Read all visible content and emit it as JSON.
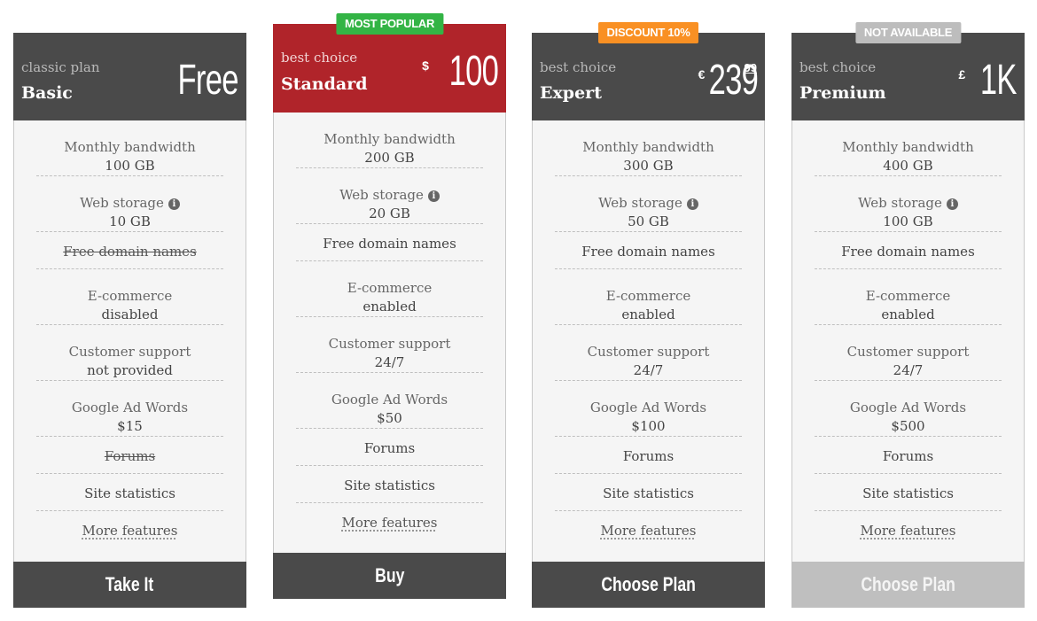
{
  "plans": [
    {
      "ribbon": "",
      "subtitle": "classic plan",
      "name": "Basic",
      "currency": "",
      "amount": "Free",
      "cents": "",
      "features": [
        {
          "label": "Monthly bandwidth",
          "value": "100 GB"
        },
        {
          "label": "Web storage",
          "value": "10 GB",
          "info": true
        },
        {
          "label": "Free domain names",
          "struck": true
        },
        {
          "label": "E-commerce",
          "value": "disabled"
        },
        {
          "label": "Customer support",
          "value": "not provided"
        },
        {
          "label": "Google Ad Words",
          "value": "$15"
        },
        {
          "label": "Forums",
          "struck": true
        },
        {
          "label": "Site statistics"
        },
        {
          "label": "More features",
          "link": true
        }
      ],
      "button": "Take It"
    },
    {
      "ribbon": "MOST POPULAR",
      "subtitle": "best choice",
      "name": "Standard",
      "currency": "$",
      "amount": "100",
      "cents": "",
      "features": [
        {
          "label": "Monthly bandwidth",
          "value": "200 GB"
        },
        {
          "label": "Web storage",
          "value": "20 GB",
          "info": true
        },
        {
          "label": "Free domain names"
        },
        {
          "label": "E-commerce",
          "value": "enabled"
        },
        {
          "label": "Customer support",
          "value": "24/7"
        },
        {
          "label": "Google Ad Words",
          "value": "$50"
        },
        {
          "label": "Forums"
        },
        {
          "label": "Site statistics"
        },
        {
          "label": "More features",
          "link": true
        }
      ],
      "button": "Buy"
    },
    {
      "ribbon": "DISCOUNT 10%",
      "subtitle": "best choice",
      "name": "Expert",
      "currency": "€",
      "amount": "239",
      "cents": "99",
      "features": [
        {
          "label": "Monthly bandwidth",
          "value": "300 GB"
        },
        {
          "label": "Web storage",
          "value": "50 GB",
          "info": true
        },
        {
          "label": "Free domain names"
        },
        {
          "label": "E-commerce",
          "value": "enabled"
        },
        {
          "label": "Customer support",
          "value": "24/7"
        },
        {
          "label": "Google Ad Words",
          "value": "$100"
        },
        {
          "label": "Forums"
        },
        {
          "label": "Site statistics"
        },
        {
          "label": "More features",
          "link": true
        }
      ],
      "button": "Choose Plan"
    },
    {
      "ribbon": "NOT AVAILABLE",
      "subtitle": "best choice",
      "name": "Premium",
      "currency": "£",
      "amount": "1K",
      "cents": "",
      "features": [
        {
          "label": "Monthly bandwidth",
          "value": "400 GB"
        },
        {
          "label": "Web storage",
          "value": "100 GB",
          "info": true
        },
        {
          "label": "Free domain names"
        },
        {
          "label": "E-commerce",
          "value": "enabled"
        },
        {
          "label": "Customer support",
          "value": "24/7"
        },
        {
          "label": "Google Ad Words",
          "value": "$500"
        },
        {
          "label": "Forums"
        },
        {
          "label": "Site statistics"
        },
        {
          "label": "More features",
          "link": true
        }
      ],
      "button": "Choose Plan",
      "button_disabled": true
    }
  ],
  "info_icon_glyph": "i",
  "colors": {
    "header_dark": "#4a4a4a",
    "header_featured": "#b0242a",
    "ribbon_popular": "#33b445",
    "ribbon_discount": "#f99023",
    "ribbon_unavailable": "#bdbdbd",
    "button_disabled": "#bfbfbf"
  }
}
